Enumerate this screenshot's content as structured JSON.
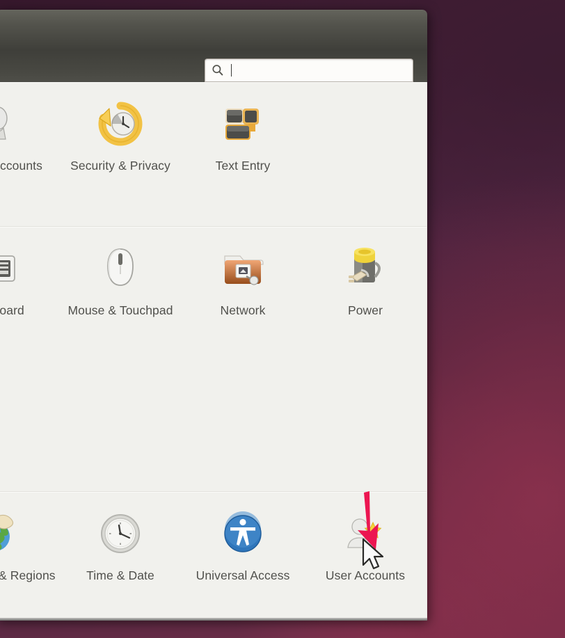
{
  "window": {
    "search": {
      "value": "",
      "placeholder": "",
      "icon": "search-icon"
    }
  },
  "sections": [
    {
      "name": "personal-section",
      "items": [
        {
          "label": "Online Accounts",
          "icon": "online-accounts-icon",
          "clipped": true
        },
        {
          "label": "Security & Privacy",
          "icon": "security-privacy-icon",
          "clipped": false
        },
        {
          "label": "Text Entry",
          "icon": "text-entry-icon",
          "clipped": false
        },
        {
          "label": "",
          "icon": "",
          "clipped": false
        }
      ]
    },
    {
      "name": "hardware-section",
      "items": [
        {
          "label": "Keyboard",
          "icon": "keyboard-icon",
          "clipped": true
        },
        {
          "label": "Mouse & Touchpad",
          "icon": "mouse-touchpad-icon",
          "clipped": false
        },
        {
          "label": "Network",
          "icon": "network-icon",
          "clipped": false
        },
        {
          "label": "Power",
          "icon": "power-icon",
          "clipped": false
        }
      ]
    },
    {
      "name": "system-section",
      "items": [
        {
          "label": "Language & Regions",
          "icon": "language-support-icon",
          "clipped": true
        },
        {
          "label": "Time & Date",
          "icon": "time-date-icon",
          "clipped": false
        },
        {
          "label": "Universal Access",
          "icon": "universal-access-icon",
          "clipped": false
        },
        {
          "label": "User Accounts",
          "icon": "user-accounts-icon",
          "clipped": false
        }
      ]
    }
  ],
  "annotation": {
    "arrow_color": "#ec1651",
    "points_at": "User Accounts",
    "cursor": "mouse-pointer-icon"
  },
  "colors": {
    "desktop": "#4e2440",
    "titlebar": "#4a4a44",
    "content_bg": "#f1f1ed",
    "label_text": "#50504c"
  }
}
